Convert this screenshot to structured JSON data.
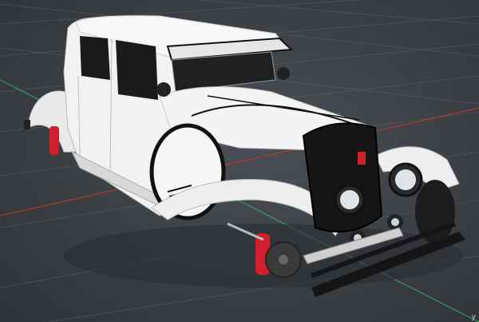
{
  "viewport": {
    "axis_label": "y",
    "colors": {
      "background": "#3b3f44",
      "grid": "#5a5f66",
      "axis_x": "#c0392b",
      "axis_z": "#2ecc71",
      "body": "#f2f2f2",
      "trim": "#111111",
      "brake": "#d0202e"
    }
  },
  "model": {
    "icon": "vintage-sedan-model"
  }
}
